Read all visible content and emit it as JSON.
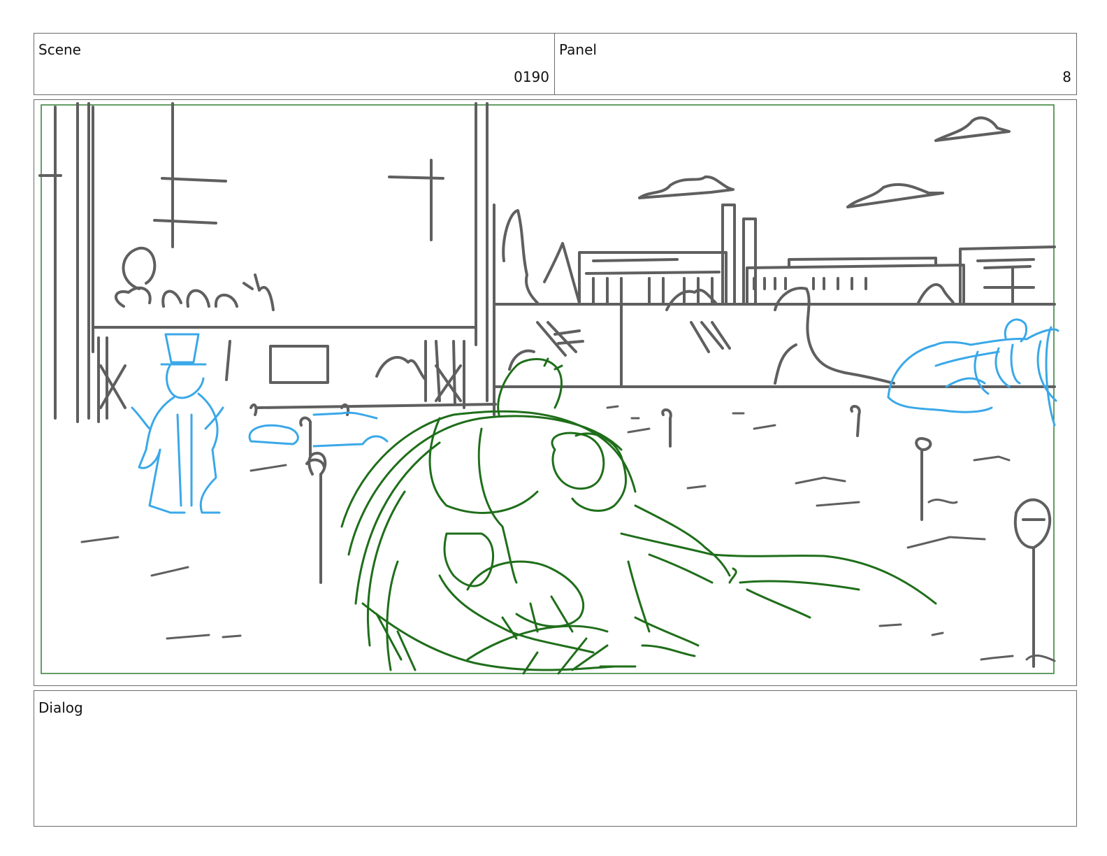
{
  "scene": {
    "label": "Scene",
    "value": "0190"
  },
  "panel": {
    "label": "Panel",
    "value": "8"
  },
  "dialog": {
    "label": "Dialog",
    "text": ""
  },
  "drawing": {
    "safe_frame_color": "#2e7d32",
    "layers": [
      {
        "name": "background",
        "color": "#5f5f5f"
      },
      {
        "name": "characters",
        "color": "#3aa8e8"
      },
      {
        "name": "foreground",
        "color": "#1f6e1a"
      }
    ]
  }
}
